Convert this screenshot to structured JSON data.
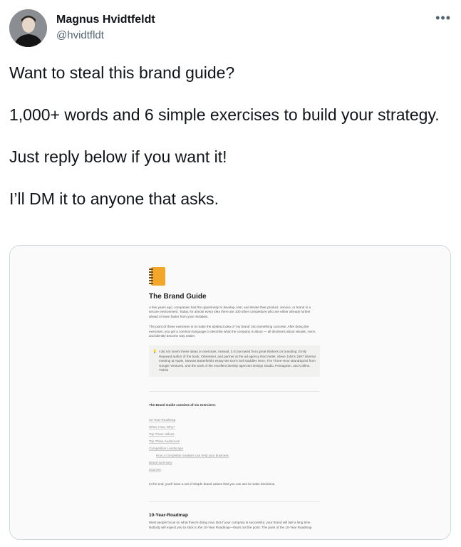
{
  "author": {
    "name": "Magnus Hvidtfeldt",
    "handle": "@hvidtfldt",
    "more_icon": "more-horizontal-icon"
  },
  "tweet": {
    "paragraphs": [
      "Want to steal this brand guide?",
      "1,000+ words and 6 simple exercises to build your strategy.",
      "Just reply below if you want it!",
      "I’ll DM it to anyone that asks."
    ]
  },
  "doc": {
    "icon": "notebook-icon",
    "title": "The Brand Guide",
    "intro": "A few years ago, companies had the opportunity to develop, test, and iterate their product, service, or brand in a secure environment. Today, for almost every idea there are 100 other competitors who are either already further ahead or learn faster from your mistakes.",
    "point": "The point of these exercises is to make the abstract idea of 'my brand' into something concrete. After doing the exercises, you get a common language to describe what the company is about — all decisions about visuals, voice, and identity become way easier.",
    "callout_icon": "lightbulb-icon",
    "callout": "I did not invent these ideas or exercises. Instead, it is borrowed from great thinkers on branding: Emily Heyward author of the book, Obsessed, and partner at the ad agency Red Antler, Steve Jobs's 1997 internal meeting at Apple, Stewart Butterfield's essay We Don't Sell Saddles Here, The Three-Hour BrandSprint from Google Ventures, and the work of the excellent identity agencies Design Studio, Pentagram, and Collins. Tinkist",
    "consists": "The Brand Guide consists of six exercises:",
    "toc": [
      {
        "label": "10-Year-Roadmap",
        "indent": false
      },
      {
        "label": "What, How, Why?",
        "indent": false
      },
      {
        "label": "Top Three Values",
        "indent": false
      },
      {
        "label": "Top Three Audiences",
        "indent": false
      },
      {
        "label": "Competitive Landscape",
        "indent": false
      },
      {
        "label": "How a competitor analysis can help your business",
        "indent": true
      },
      {
        "label": "Brand summary",
        "indent": false
      },
      {
        "label": "Sources",
        "indent": false
      }
    ],
    "end": "In the end, you'll have a set of simple brand values that you can use to make decisions.",
    "section_title": "10-Year-Roadmap",
    "section_text": "Most people focus on what they're doing now. But if your company is successful, your brand will last a long time. Nobody will expect you to stick to the 10-Year Roadmap—that's not the point. The point of the 10-Year Roadmap"
  }
}
